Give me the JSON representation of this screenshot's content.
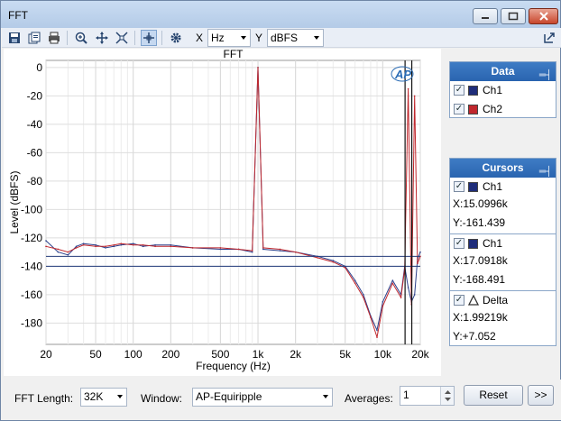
{
  "window": {
    "title": "FFT"
  },
  "toolbar": {
    "x_label": "X",
    "x_unit": "Hz",
    "y_label": "Y",
    "y_unit": "dBFS"
  },
  "chart_data": {
    "type": "line",
    "title": "FFT",
    "xlabel": "Frequency (Hz)",
    "ylabel": "Level (dBFS)",
    "x_scale": "log",
    "xlim": [
      20,
      20000
    ],
    "ylim": [
      -195,
      5
    ],
    "x_ticks": [
      20,
      50,
      100,
      200,
      500,
      1000,
      2000,
      5000,
      10000,
      20000
    ],
    "x_tick_labels": [
      "20",
      "50",
      "100",
      "200",
      "500",
      "1k",
      "2k",
      "5k",
      "10k",
      "20k"
    ],
    "y_ticks": [
      0,
      -20,
      -40,
      -60,
      -80,
      -100,
      -120,
      -140,
      -160,
      -180
    ],
    "y_tick_labels": [
      "0",
      "-20",
      "-40",
      "-60",
      "-80",
      "-100",
      "-120",
      "-140",
      "-160",
      "-180"
    ],
    "grid": true,
    "series": [
      {
        "name": "Ch1",
        "color": "#2b3f8a",
        "x": [
          20,
          25,
          30,
          35,
          40,
          50,
          60,
          70,
          80,
          100,
          120,
          150,
          200,
          300,
          500,
          700,
          900,
          1000,
          1100,
          1500,
          2000,
          3000,
          4000,
          5000,
          6000,
          7000,
          8000,
          9000,
          10000,
          12000,
          14000,
          15000,
          16000,
          17000,
          18000,
          19000,
          20000
        ],
        "values": [
          -122,
          -130,
          -132,
          -126,
          -124,
          -125,
          -127,
          -126,
          -125,
          -124,
          -126,
          -125,
          -125,
          -127,
          -128,
          -128,
          -130,
          0,
          -128,
          -129,
          -130,
          -133,
          -136,
          -140,
          -150,
          -160,
          -175,
          -185,
          -165,
          -150,
          -160,
          -140,
          -155,
          -165,
          -160,
          -135,
          -130
        ]
      },
      {
        "name": "Ch2",
        "color": "#c0272d",
        "x": [
          20,
          25,
          30,
          35,
          40,
          50,
          60,
          70,
          80,
          100,
          120,
          150,
          200,
          300,
          500,
          700,
          900,
          1000,
          1100,
          1500,
          2000,
          3000,
          4000,
          5000,
          6000,
          7000,
          8000,
          9000,
          10000,
          12000,
          14000,
          15000,
          16000,
          17000,
          18000,
          19000,
          20000
        ],
        "values": [
          -126,
          -128,
          -130,
          -127,
          -125,
          -126,
          -126,
          -125,
          -124,
          -125,
          -125,
          -126,
          -126,
          -127,
          -127,
          -128,
          -129,
          0,
          -127,
          -128,
          -130,
          -134,
          -137,
          -141,
          -152,
          -162,
          -176,
          -190,
          -168,
          -152,
          -162,
          -142,
          -15,
          -167,
          -20,
          -138,
          -133
        ]
      }
    ],
    "cursor_lines": [
      {
        "x": 15099.6,
        "y": -161.439
      },
      {
        "x": 17091.8,
        "y": -168.491
      }
    ],
    "reference_lines_y": [
      -133,
      -140
    ],
    "logo": "AP"
  },
  "data_panel": {
    "title": "Data",
    "items": [
      {
        "label": "Ch1",
        "checked": true,
        "color": "#1f2d7a"
      },
      {
        "label": "Ch2",
        "checked": true,
        "color": "#c0272d"
      }
    ]
  },
  "cursors_panel": {
    "title": "Cursors",
    "cursors": [
      {
        "label": "Ch1",
        "checked": true,
        "color": "#1f2d7a",
        "x": "X:15.0996k",
        "y": "Y:-161.439"
      },
      {
        "label": "Ch1",
        "checked": true,
        "color": "#1f2d7a",
        "x": "X:17.0918k",
        "y": "Y:-168.491"
      },
      {
        "label": "Delta",
        "checked": true,
        "icon": "delta-icon",
        "x": "X:1.99219k",
        "y": "Y:+7.052"
      }
    ]
  },
  "bottom": {
    "fft_length_label": "FFT Length:",
    "fft_length_value": "32K",
    "window_label": "Window:",
    "window_value": "AP-Equiripple",
    "averages_label": "Averages:",
    "averages_value": "1",
    "reset_label": "Reset",
    "more_label": ">>"
  }
}
